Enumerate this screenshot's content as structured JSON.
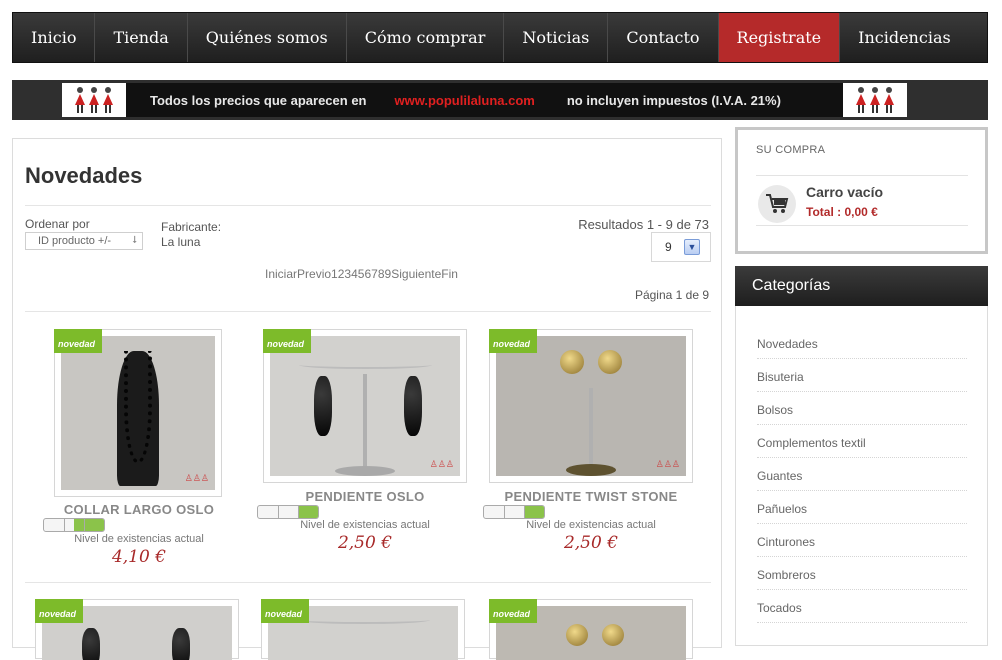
{
  "nav": {
    "items": [
      "Inicio",
      "Tienda",
      "Quiénes somos",
      "Cómo comprar",
      "Noticias",
      "Contacto",
      "Registrate",
      "Incidencias"
    ],
    "active": "Registrate"
  },
  "banner": {
    "text_before": "Todos los precios que aparecen en",
    "site": "www.populilaluna.com",
    "text_after": "no incluyen impuestos (I.V.A. 21%)"
  },
  "main": {
    "title": "Novedades",
    "sort_label": "Ordenar por",
    "sort_value": "ID producto +/-",
    "maker_label": "Fabricante:",
    "maker_value": "La luna",
    "results": "Resultados 1 - 9 de 73",
    "per_page": "9",
    "pagination": [
      "Iniciar",
      "Previo",
      "1",
      "2",
      "3",
      "4",
      "5",
      "6",
      "7",
      "8",
      "9",
      "Siguiente",
      "Fin"
    ],
    "page_of": "Página 1 de 9",
    "badge": "novedad",
    "stock_label": "Nivel de existencias actual",
    "products": [
      {
        "name": "COLLAR LARGO OSLO",
        "price": "4,10 €",
        "stock": 0.5
      },
      {
        "name": "PENDIENTE OSLO",
        "price": "2,50 €",
        "stock": 0.33
      },
      {
        "name": "PENDIENTE TWIST STONE",
        "price": "2,50 €",
        "stock": 0.33
      }
    ]
  },
  "cart": {
    "title": "SU COMPRA",
    "empty": "Carro vacío",
    "total": "Total : 0,00 €"
  },
  "categories": {
    "title": "Categorías",
    "items": [
      "Novedades",
      "Bisuteria",
      "Bolsos",
      "Complementos textil",
      "Guantes",
      "Pañuelos",
      "Cinturones",
      "Sombreros",
      "Tocados"
    ]
  },
  "colors": {
    "accent": "#b52a2a",
    "badge": "#7dbb2a",
    "price": "#a82a2a"
  }
}
